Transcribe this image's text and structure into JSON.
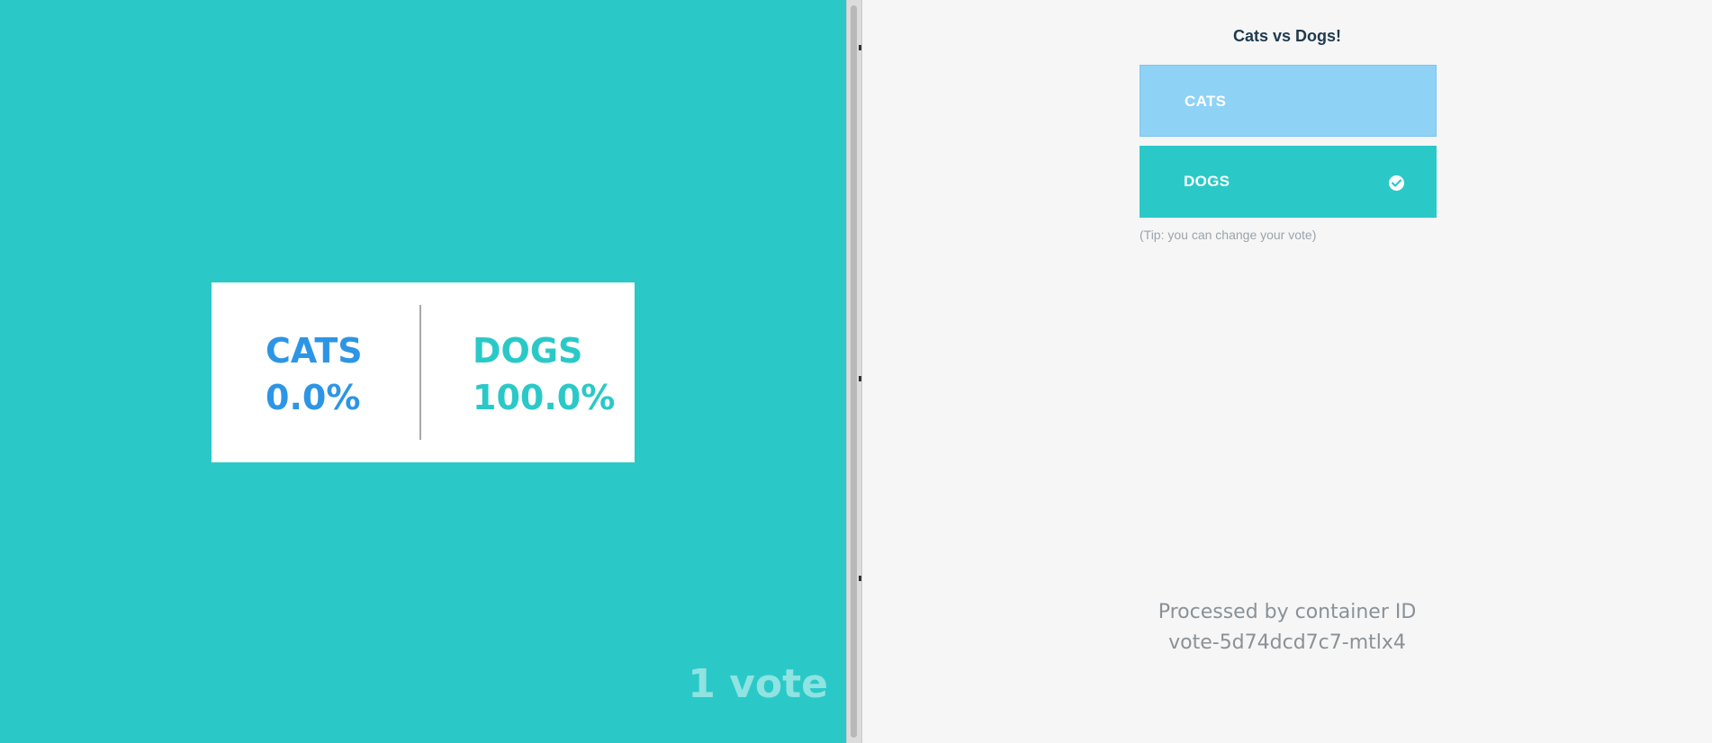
{
  "results": {
    "cats_label": "CATS",
    "cats_percent": "0.0%",
    "dogs_label": "DOGS",
    "dogs_percent": "100.0%",
    "vote_count": "1 vote",
    "colors": {
      "background": "#2ac9c8",
      "cats": "#2d95e5",
      "dogs": "#2ac9c8"
    }
  },
  "vote": {
    "title": "Cats vs Dogs!",
    "options": [
      {
        "label": "CATS",
        "selected": false,
        "color": "#8ed2f6"
      },
      {
        "label": "DOGS",
        "selected": true,
        "color": "#2ac9c8",
        "icon": "check-circle-icon"
      }
    ],
    "tip": "(Tip: you can change your vote)",
    "processed_line1": "Processed by container ID",
    "processed_line2": "vote-5d74dcd7c7-mtlx4"
  }
}
